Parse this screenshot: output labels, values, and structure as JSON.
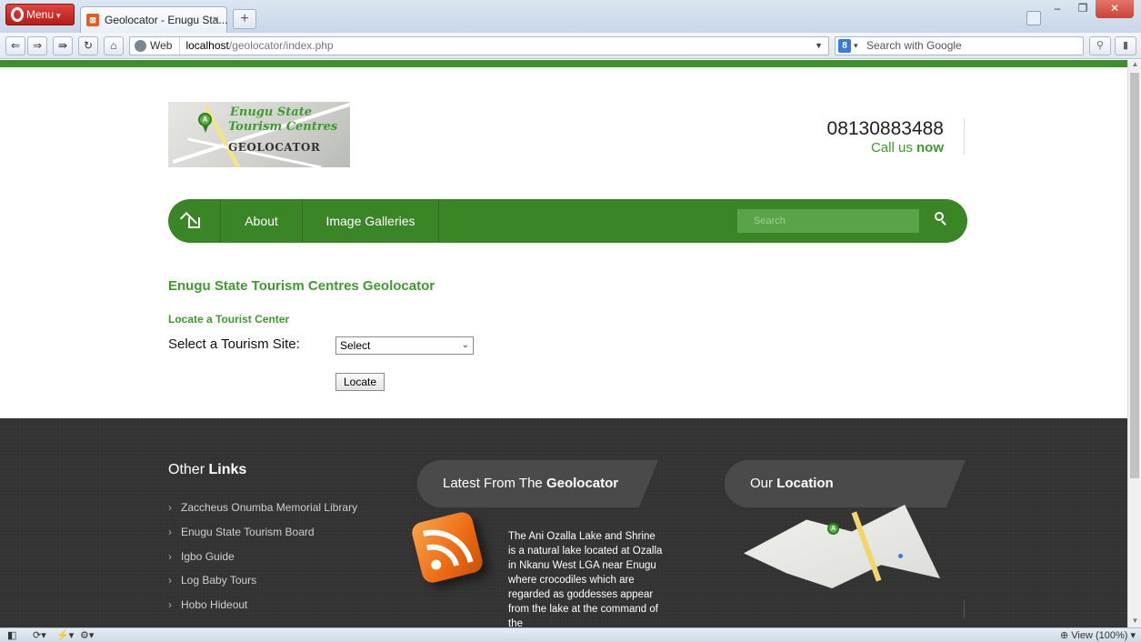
{
  "browser": {
    "menu_label": "Menu",
    "tab_title": "Geolocator - Enugu Sta...",
    "tab_close": "×",
    "new_tab": "+",
    "address_prefix": "Web",
    "address_host": "localhost",
    "address_path": "/geolocator/index.php",
    "search_placeholder": "Search with Google",
    "zoom_label": "View (100%)"
  },
  "header": {
    "logo_line1": "Enugu State",
    "logo_line2": "Tourism Centres",
    "logo_line3": "GEOLOCATOR",
    "phone": "08130883488",
    "call_prefix": "Call us",
    "call_emphasis": "now"
  },
  "nav": {
    "about": "About",
    "galleries": "Image Galleries",
    "search_placeholder": "Search"
  },
  "main": {
    "title": "Enugu State Tourism Centres Geolocator",
    "subtitle": "Locate a Tourist Center",
    "select_label": "Select a Tourism Site:",
    "select_value": "Select",
    "locate_button": "Locate"
  },
  "footer": {
    "links_title_prefix": "Other",
    "links_title_emphasis": "Links",
    "links": [
      "Zaccheus Onumba Memorial Library",
      "Enugu State Tourism Board",
      "Igbo Guide",
      "Log Baby Tours",
      "Hobo Hideout"
    ],
    "latest_prefix": "Latest From The",
    "latest_emphasis": "Geolocator",
    "latest_text": "The Ani Ozalla Lake and Shrine is a natural lake located at Ozalla in Nkanu West LGA near Enugu where crocodiles which are regarded as goddesses appear from the lake at the command of the",
    "location_prefix": "Our",
    "location_emphasis": "Location"
  },
  "colors": {
    "brand_green": "#3a8526",
    "text_green": "#3f9a2f",
    "footer_bg": "#333333"
  }
}
